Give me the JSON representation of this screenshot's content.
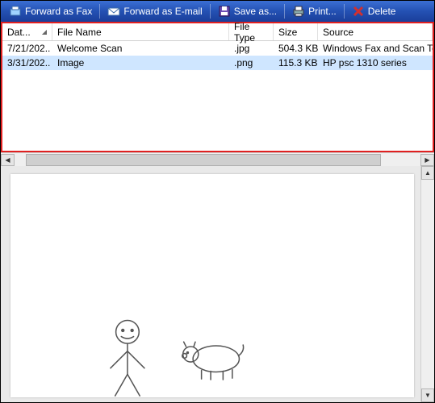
{
  "toolbar": {
    "forward_fax": "Forward as Fax",
    "forward_email": "Forward as E-mail",
    "save_as": "Save as...",
    "print": "Print...",
    "delete": "Delete"
  },
  "columns": {
    "date": "Dat...",
    "file_name": "File Name",
    "file_type": "File Type",
    "size": "Size",
    "source": "Source"
  },
  "rows": [
    {
      "date": "7/21/202..",
      "file_name": "Welcome Scan",
      "file_type": ".jpg",
      "size": "504.3 KB",
      "source": "Windows Fax and Scan Team",
      "selected": false
    },
    {
      "date": "3/31/202..",
      "file_name": "Image",
      "file_type": ".png",
      "size": "115.3 KB",
      "source": "HP psc 1310 series",
      "selected": true
    }
  ],
  "icons": {
    "fax": "fax-icon",
    "email": "email-icon",
    "save": "save-icon",
    "print": "print-icon",
    "delete": "delete-icon"
  }
}
